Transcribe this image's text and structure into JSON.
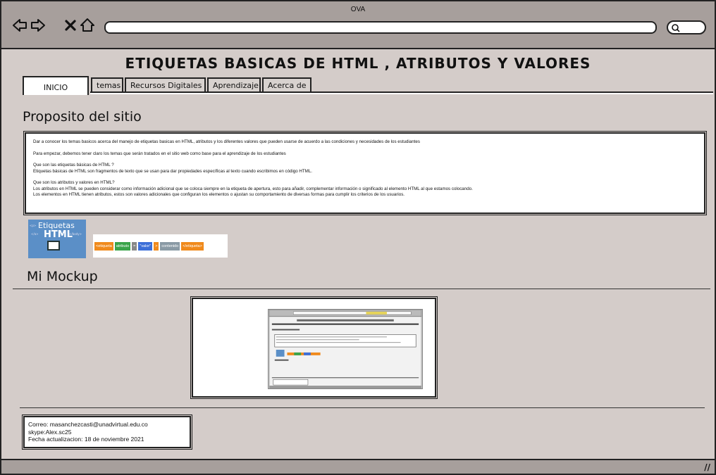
{
  "window": {
    "title": "OVA"
  },
  "nav": {
    "back_icon": "back-arrow-icon",
    "forward_icon": "forward-arrow-icon",
    "close_icon": "close-icon",
    "home_icon": "home-icon",
    "address_value": "",
    "search_icon": "search-icon"
  },
  "page": {
    "title": "ETIQUETAS BASICAS DE HTML , ATRIBUTOS Y VALORES",
    "tabs": [
      {
        "label": "INICIO",
        "active": true
      },
      {
        "label": "temas"
      },
      {
        "label": "Recursos Digitales"
      },
      {
        "label": "Aprendizaje"
      },
      {
        "label": "Acerca de"
      }
    ]
  },
  "proposito": {
    "heading": "Proposito del sitio",
    "paragraphs": [
      "Dar a conocer los temas basicos acerca del manejo de etiquetas basicas en HTML, atributos y los diferentes valores que pueden usarse de acuerdo a las condiciones y necesidades de los estudiantes",
      "Para empezar, debemos tener claro los temas que serán tratados en el sitio web como base para el aprendizaje de los estudiantes",
      "Que son las etiquetas básicas de HTML ?",
      "Etiquetas básicas de HTML son fragmentos de texto que se usan para dar propiedades específicas al texto cuando escribimos en código HTML.",
      "Que son los atributos y valores en HTML?",
      "Los atributos en HTML se pueden considerar como información adicional que se coloca siempre en la etiqueta de apertura, esto para añadir, complementar información o significado al elemento HTML al que estamos colocando.",
      "Los elementos en HTML tienen atributos, estos son valores adicionales que configuran los elementos o ajustan su comportamiento de diversas formas para cumplir los criterios de los usuarios."
    ]
  },
  "images": {
    "etiquetas_line1": "Etiquetas",
    "etiquetas_line2": "HTML",
    "syntax": [
      {
        "text": "<etiqueta",
        "color": "#f08a1c"
      },
      {
        "text": "atributo",
        "color": "#3aa44a"
      },
      {
        "text": "=",
        "color": "#888888"
      },
      {
        "text": "\"valor\"",
        "color": "#3c6fd8"
      },
      {
        "text": ">",
        "color": "#f08a1c"
      },
      {
        "text": "contenido",
        "color": "#8a9aa5"
      },
      {
        "text": "</etiqueta>",
        "color": "#f08a1c"
      }
    ]
  },
  "mockup": {
    "heading": "Mi Mockup"
  },
  "footer": {
    "correo": "Correo: masanchezcasti@unadvirtual.edu.co",
    "skype": "skype:Alex.sc25",
    "fecha": "Fecha actualizacion: 18 de noviembre 2021"
  },
  "colors": {
    "chrome": "#a79f9c",
    "page_bg": "#d4ccc9",
    "border": "#222222"
  }
}
